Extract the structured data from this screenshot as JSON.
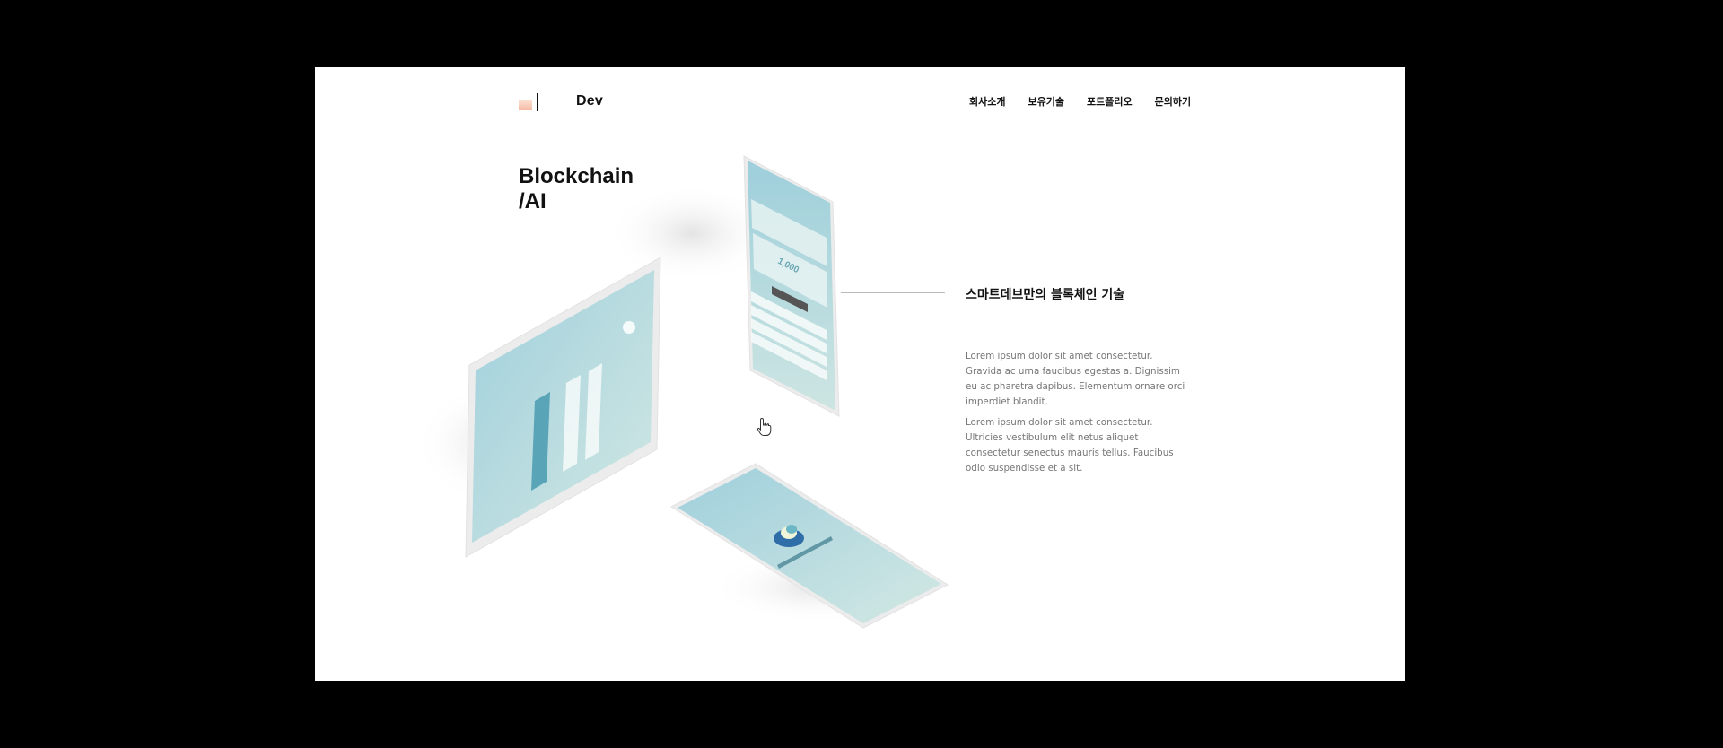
{
  "header": {
    "brand": "Dev",
    "nav": [
      "회사소개",
      "보유기술",
      "포트폴리오",
      "문의하기"
    ]
  },
  "hero": {
    "title_line1": "Blockchain",
    "title_line2": "/AI"
  },
  "feature": {
    "heading": "스마트데브만의 블록체인 기술",
    "paragraph1": "Lorem ipsum dolor sit amet consectetur. Gravida ac urna faucibus egestas a. Dignissim eu ac pharetra dapibus. Elementum ornare orci imperdiet blandit.",
    "paragraph2": "Lorem ipsum dolor sit amet consectetur. Ultricies vestibulum elit netus aliquet consectetur senectus mauris tellus. Faucibus odio suspendisse et a sit."
  },
  "phone_wallet": {
    "amount": "1,000"
  },
  "colors": {
    "page_background": "#ffffff",
    "frame_background": "#000000",
    "screen_teal": "#a9d3dd",
    "logo_peach": "#f5b9a2",
    "logo_blue": "#2e6da8"
  },
  "icons": [
    "hand-pointer-cursor-icon",
    "platform-logo-icon"
  ]
}
